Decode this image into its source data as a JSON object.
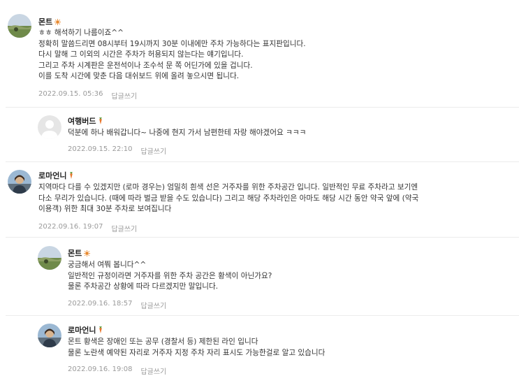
{
  "comments": [
    {
      "author": "몬트",
      "badge": "sun",
      "lines": [
        "ㅎㅎ 해석하기 나름이죠^^",
        "정확히 말씀드리면 08시부터 19시까지 30분 이내에만 주차 가능하다는 표지판입니다.",
        "다시 말해 그 이외의 시간은 주차가 허용되지 않는다는 얘기입니다.",
        "그리고 주차 시계판은 운전석이나 조수석 문 쪽 어딘가에 있을 겁니다.",
        "이를 도착 시간에 맞춘 다음 대쉬보드 위에 올려 놓으시면 됩니다."
      ],
      "date": "2022.09.15. 05:36",
      "reply": "답글쓰기"
    },
    {
      "author": "여행버드",
      "badge": "carrot",
      "lines": [
        "덕분에 하나 배워갑니다~ 나중에 현지 가서 남편한테 자랑 해야겠어요 ㅋㅋㅋ"
      ],
      "date": "2022.09.15. 22:10",
      "reply": "답글쓰기"
    },
    {
      "author": "로마언니",
      "badge": "carrot",
      "lines": [
        "지역마다 다를 수 있겠지만 (로마 경우는) 엄밀히 흰색 선은 거주자를 위한 주차공간 입니다. 일반적인 무료 주차라고 보기엔",
        "다소 무리가 있습니다. (때에 따라 벌금 받을 수도 있습니다) 그리고 해당 주차라인은 아마도 해당 시간 동안 약국 앞에 (약국",
        "이용객) 위한 최대 30분 주차로 보여집니다"
      ],
      "date": "2022.09.16. 19:07",
      "reply": "답글쓰기"
    },
    {
      "author": "몬트",
      "badge": "sun",
      "lines": [
        "궁금해서 여쭤 봅니다^^",
        "일반적인 규정이라면 거주자를 위한 주차 공간은 황색이 아닌가요?",
        "물론 주차공간 상황에 따라 다르겠지만 말입니다."
      ],
      "date": "2022.09.16. 18:57",
      "reply": "답글쓰기"
    },
    {
      "author": "로마언니",
      "badge": "carrot",
      "lines": [
        "몬트 황색은 장애인 또는 공무 (경찰서 등) 제한된 라인 입니다",
        "물론 노란색 예약된 자리로 거주자 지정 주차 자리 표시도 가능한걸로 알고 있습니다"
      ],
      "date": "2022.09.16. 19:08",
      "reply": "답글쓰기"
    }
  ]
}
